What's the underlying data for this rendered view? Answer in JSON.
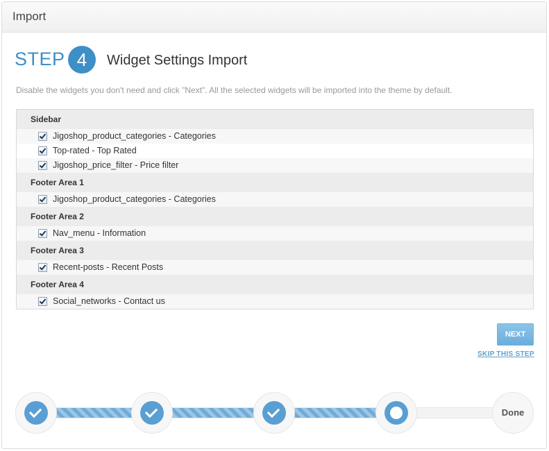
{
  "panel": {
    "title": "Import"
  },
  "step": {
    "word": "STEP",
    "number": "4",
    "title": "Widget Settings Import",
    "description": "Disable the widgets you don't need and click \"Next\". All the selected widgets will be imported into the theme by default."
  },
  "groups": [
    {
      "name": "Sidebar",
      "items": [
        {
          "label": "Jigoshop_product_categories - Categories",
          "checked": true
        },
        {
          "label": "Top-rated - Top Rated",
          "checked": true
        },
        {
          "label": "Jigoshop_price_filter - Price filter",
          "checked": true
        }
      ]
    },
    {
      "name": "Footer Area 1",
      "items": [
        {
          "label": "Jigoshop_product_categories - Categories",
          "checked": true
        }
      ]
    },
    {
      "name": "Footer Area 2",
      "items": [
        {
          "label": "Nav_menu - Information",
          "checked": true
        }
      ]
    },
    {
      "name": "Footer Area 3",
      "items": [
        {
          "label": "Recent-posts - Recent Posts",
          "checked": true
        }
      ]
    },
    {
      "name": "Footer Area 4",
      "items": [
        {
          "label": "Social_networks - Contact us",
          "checked": true
        }
      ]
    }
  ],
  "actions": {
    "next_label": "NEXT",
    "skip_label": "SKIP THIS STEP"
  },
  "progress": {
    "completed_steps": 3,
    "current_step": 4,
    "final_label": "Done",
    "accent_color": "#5a9fd3"
  }
}
